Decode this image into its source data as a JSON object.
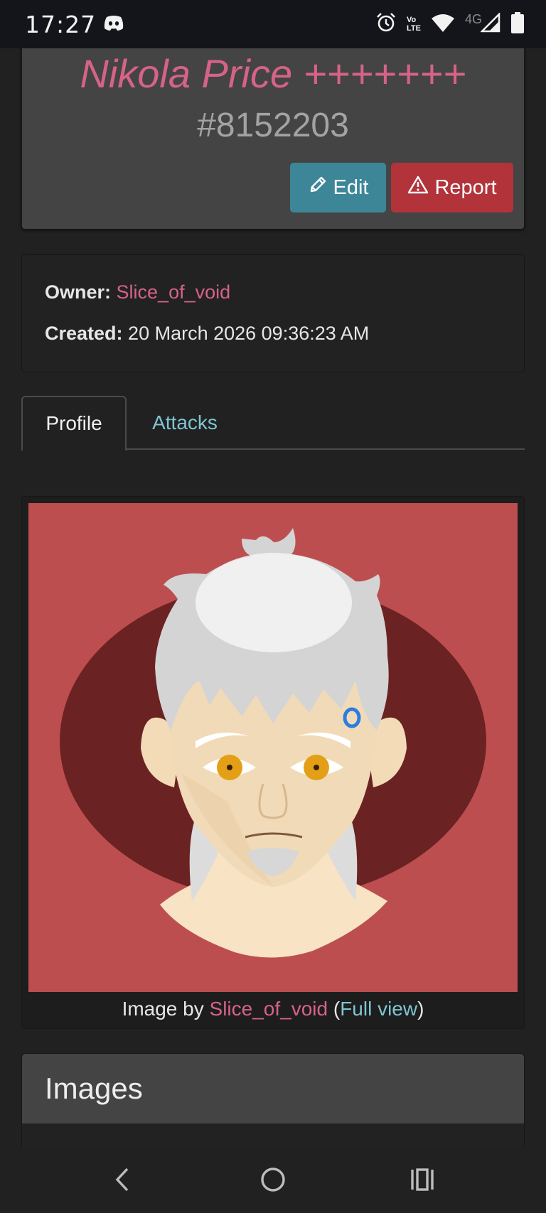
{
  "status_bar": {
    "time": "17:27",
    "volte_top": "Vo",
    "volte_bottom": "LTE",
    "network": "4G",
    "icons": [
      "discord-icon",
      "alarm-icon",
      "volte-icon",
      "wifi-icon",
      "signal-icon",
      "battery-icon"
    ]
  },
  "character": {
    "name": "Nikola Price +++++++",
    "id": "#8152203"
  },
  "actions": {
    "edit_label": "Edit",
    "report_label": "Report"
  },
  "info": {
    "owner_label": "Owner:",
    "owner_value": "Slice_of_void",
    "created_label": "Created:",
    "created_value": "20 March 2026 09:36:23 AM"
  },
  "tabs": {
    "profile": "Profile",
    "attacks": "Attacks"
  },
  "image": {
    "caption_prefix": "Image by ",
    "artist": "Slice_of_void",
    "paren_open": " (",
    "full_view": "Full view",
    "paren_close": ")"
  },
  "sections": {
    "images_title": "Images"
  },
  "colors": {
    "accent_pink": "#d66387",
    "accent_teal": "#7ec5d2",
    "edit_button": "#3d8698",
    "report_button": "#b3333a",
    "portrait_bg": "#bd4e4f"
  }
}
